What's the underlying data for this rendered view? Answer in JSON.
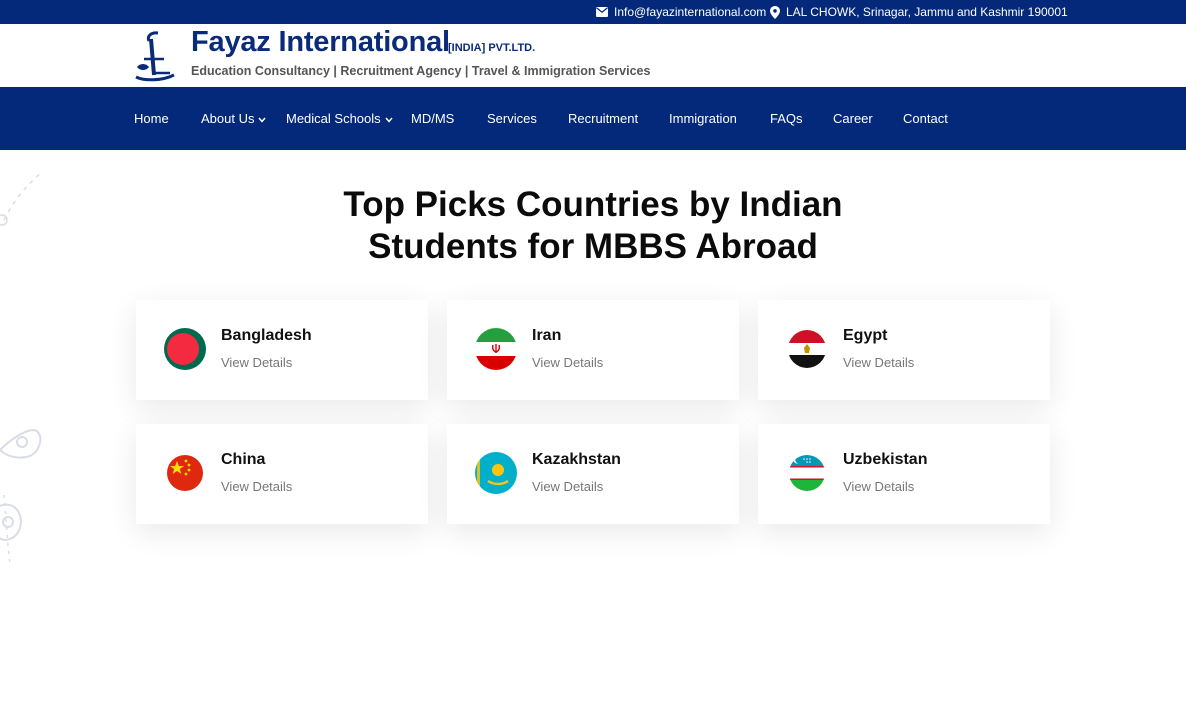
{
  "topbar": {
    "email": "Info@fayazinternational.com",
    "address": "LAL CHOWK, Srinagar, Jammu and Kashmir 190001",
    "email_icon": "envelope-icon",
    "address_icon": "map-pin-icon"
  },
  "header": {
    "brand": "Fayaz International",
    "brand_suffix": "[INDIA] PVT.LTD.",
    "tagline": "Education Consultancy | Recruitment Agency | Travel & Immigration Services"
  },
  "nav": {
    "items": [
      {
        "label": "Home"
      },
      {
        "label": "About Us"
      },
      {
        "label": "Medical Schools"
      },
      {
        "label": "MD/MS"
      },
      {
        "label": "Services"
      },
      {
        "label": "Recruitment"
      },
      {
        "label": "Immigration"
      },
      {
        "label": "FAQs"
      },
      {
        "label": "Career"
      },
      {
        "label": "Contact"
      }
    ]
  },
  "section": {
    "title_line1": "Top Picks Countries by Indian",
    "title_line2": "Students for MBBS Abroad"
  },
  "countries": [
    {
      "name": "Bangladesh",
      "link": "View Details"
    },
    {
      "name": "Iran",
      "link": "View Details"
    },
    {
      "name": "Egypt",
      "link": "View Details"
    },
    {
      "name": "China",
      "link": "View Details"
    },
    {
      "name": "Kazakhstan",
      "link": "View Details"
    },
    {
      "name": "Uzbekistan",
      "link": "View Details"
    }
  ],
  "colors": {
    "brand_navy": "#04297a",
    "logo_text": "#0a2b78"
  }
}
